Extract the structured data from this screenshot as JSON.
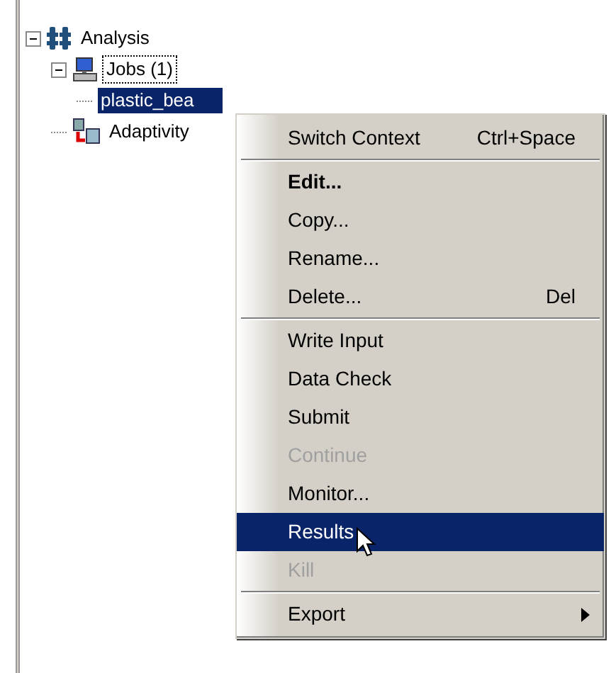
{
  "tree": [
    {
      "label": "Analysis",
      "kind": "analysis",
      "expanded": true,
      "selected": false,
      "focused": false,
      "children": [
        {
          "label": "Jobs (1)",
          "kind": "jobs",
          "expanded": true,
          "selected": false,
          "focused": true,
          "children": [
            {
              "label": "plastic_bea",
              "selected": true,
              "focused": false
            }
          ]
        },
        {
          "label": "Adaptivity",
          "kind": "adaptivity",
          "selected": false,
          "focused": false
        }
      ]
    }
  ],
  "menu": [
    {
      "kind": "item",
      "label": "Switch Context",
      "shortcut": "Ctrl+Space",
      "bold": false,
      "disabled": false,
      "selected": false
    },
    {
      "kind": "separator"
    },
    {
      "kind": "item",
      "label": "Edit...",
      "bold": true,
      "disabled": false,
      "selected": false
    },
    {
      "kind": "item",
      "label": "Copy...",
      "bold": false,
      "disabled": false,
      "selected": false
    },
    {
      "kind": "item",
      "label": "Rename...",
      "bold": false,
      "disabled": false,
      "selected": false
    },
    {
      "kind": "item",
      "label": "Delete...",
      "shortcut": "Del",
      "bold": false,
      "disabled": false,
      "selected": false
    },
    {
      "kind": "separator"
    },
    {
      "kind": "item",
      "label": "Write Input",
      "bold": false,
      "disabled": false,
      "selected": false
    },
    {
      "kind": "item",
      "label": "Data Check",
      "bold": false,
      "disabled": false,
      "selected": false
    },
    {
      "kind": "item",
      "label": "Submit",
      "bold": false,
      "disabled": false,
      "selected": false
    },
    {
      "kind": "item",
      "label": "Continue",
      "bold": false,
      "disabled": true,
      "selected": false
    },
    {
      "kind": "item",
      "label": "Monitor...",
      "bold": false,
      "disabled": false,
      "selected": false
    },
    {
      "kind": "item",
      "label": "Results",
      "bold": false,
      "disabled": false,
      "selected": true
    },
    {
      "kind": "item",
      "label": "Kill",
      "bold": false,
      "disabled": true,
      "selected": false
    },
    {
      "kind": "separator"
    },
    {
      "kind": "item",
      "label": "Export",
      "bold": false,
      "disabled": false,
      "selected": false,
      "submenu": true
    }
  ]
}
